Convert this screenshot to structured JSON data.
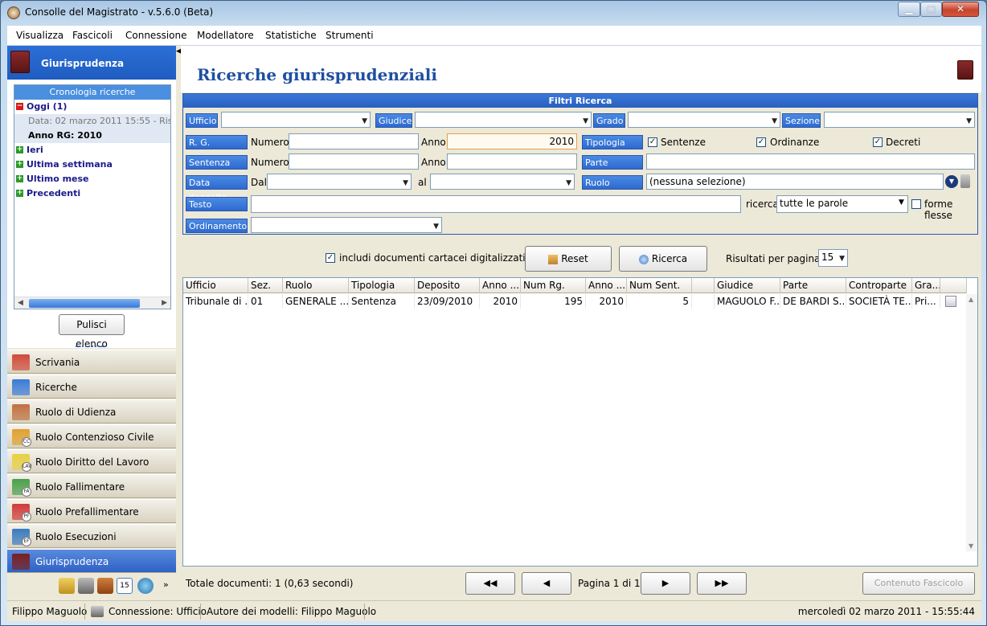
{
  "window": {
    "title": "Consolle del Magistrato - v.5.6.0 (Beta)"
  },
  "menu": [
    "Visualizza",
    "Fascicoli",
    "Connessione",
    "Modellatore",
    "Statistiche",
    "Strumenti"
  ],
  "left_panel": {
    "header": "Giurisprudenza",
    "history_title": "Cronologia ricerche",
    "tree": {
      "today": "Oggi (1)",
      "today_detail": "Data: 02 marzo 2011 15:55 - Risult",
      "today_detail2": "Anno RG: 2010",
      "yesterday": "Ieri",
      "last_week": "Ultima settimana",
      "last_month": "Ultimo mese",
      "previous": "Precedenti"
    },
    "clear_button": "Pulisci elenco",
    "nav": [
      {
        "label": "Scrivania",
        "color": "#d04a3a"
      },
      {
        "label": "Ricerche",
        "color": "#3a7ad8"
      },
      {
        "label": "Ruolo di Udienza",
        "color": "#c07040"
      },
      {
        "label": "Ruolo Contenzioso Civile",
        "color": "#e0a030",
        "badge": "CC"
      },
      {
        "label": "Ruolo Diritto del Lavoro",
        "color": "#e8d040",
        "badge": "LAV"
      },
      {
        "label": "Ruolo Fallimentare",
        "color": "#4aa04a",
        "badge": "FA"
      },
      {
        "label": "Ruolo Prefallimentare",
        "color": "#d03a3a",
        "badge": "PF"
      },
      {
        "label": "Ruolo Esecuzioni",
        "color": "#3a7ac0",
        "badge": "EF"
      },
      {
        "label": "Giurisprudenza",
        "color": "#7a2020"
      }
    ],
    "calendar_day": "15"
  },
  "right_panel": {
    "title": "Ricerche giurisprudenziali",
    "filters_title": "Filtri Ricerca",
    "labels": {
      "ufficio": "Ufficio",
      "giudice": "Giudice",
      "grado": "Grado",
      "sezione": "Sezione",
      "rg": "R. G.",
      "numero": "Numero",
      "anno": "Anno",
      "tipologia": "Tipologia",
      "sentenze": "Sentenze",
      "ordinanze": "Ordinanze",
      "decreti": "Decreti",
      "sentenza": "Sentenza",
      "parte": "Parte",
      "data_deposito": "Data deposito",
      "dal": "Dal",
      "al": "al",
      "ruolo": "Ruolo",
      "ruolo_value": "(nessuna selezione)",
      "testo": "Testo",
      "ricerca": "ricerca",
      "ricerca_value": "tutte le parole",
      "forme_flesse": "forme flesse",
      "ordinamento": "Ordinamento"
    },
    "rg_anno_value": "2010",
    "include_digital": "includi documenti cartacei digitalizzati",
    "reset_button": "Reset",
    "search_button": "Ricerca",
    "per_page_label": "Risultati per pagina:",
    "per_page_value": "15",
    "columns": [
      "Ufficio",
      "Sez.",
      "Ruolo",
      "Tipologia",
      "Deposito",
      "Anno ...",
      "Num Rg.",
      "Anno ...",
      "Num Sent.",
      "",
      "Giudice",
      "Parte",
      "Controparte",
      "Gra...",
      ""
    ],
    "rows": [
      [
        "Tribunale di ...",
        "01",
        "GENERALE ...",
        "Sentenza",
        "23/09/2010",
        "2010",
        "195",
        "2010",
        "5",
        "",
        "MAGUOLO F...",
        "DE BARDI S...",
        "SOCIETÀ TE...",
        "Pri...",
        ""
      ]
    ],
    "total_label": "Totale documenti:",
    "total_value": "1",
    "total_time": "(0,63 secondi)",
    "page_label": "Pagina 1 di 1",
    "contenuto_button": "Contenuto Fascicolo"
  },
  "status_bar": {
    "user": "Filippo Maguolo",
    "connection": "Connessione: Ufficio",
    "author": "Autore dei modelli: Filippo Maguolo",
    "datetime": "mercoledì 02 marzo 2011 - 15:55:44"
  }
}
